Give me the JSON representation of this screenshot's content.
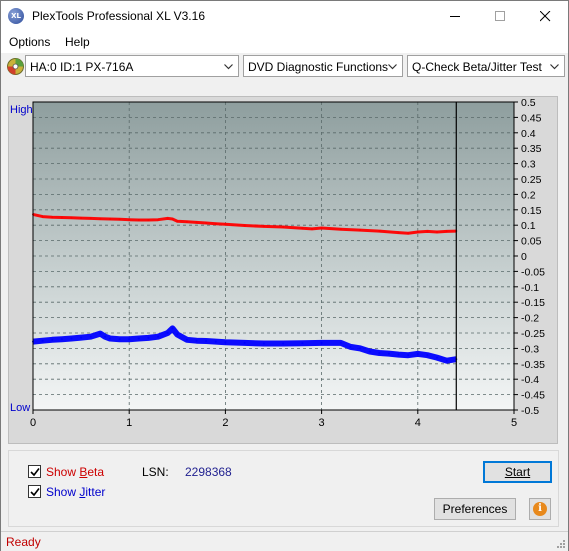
{
  "window": {
    "title": "PlexTools Professional XL V3.16",
    "app_icon_text": "XL"
  },
  "menu": {
    "options": "Options",
    "help": "Help"
  },
  "toolbar": {
    "drive": "HA:0 ID:1  PX-716A",
    "function": "DVD Diagnostic Functions",
    "test": "Q-Check Beta/Jitter Test"
  },
  "chart_data": {
    "type": "line",
    "title": "",
    "xlabel": "",
    "ylabel": "",
    "left_axis": {
      "top_label": "High",
      "bottom_label": "Low"
    },
    "xlim": [
      0,
      5
    ],
    "x_ticks": [
      "0",
      "1",
      "2",
      "3",
      "4",
      "5"
    ],
    "ylim": [
      -0.5,
      0.5
    ],
    "y_ticks": [
      "0.5",
      "0.45",
      "0.4",
      "0.35",
      "0.3",
      "0.25",
      "0.2",
      "0.15",
      "0.1",
      "0.05",
      "0",
      "-0.05",
      "-0.1",
      "-0.15",
      "-0.2",
      "-0.25",
      "-0.3",
      "-0.35",
      "-0.4",
      "-0.45",
      "-0.5"
    ],
    "grid": true,
    "end_marker_x": 4.4,
    "colors": {
      "beta": "#ff0000",
      "jitter": "#0000ff",
      "marker": "#000000"
    },
    "series": [
      {
        "key": "beta",
        "x": [
          0,
          0.1,
          0.2,
          0.3,
          0.4,
          0.5,
          0.6,
          0.7,
          0.8,
          0.9,
          1.0,
          1.1,
          1.2,
          1.3,
          1.4,
          1.45,
          1.5,
          1.6,
          1.7,
          1.8,
          1.9,
          2.0,
          2.2,
          2.4,
          2.6,
          2.8,
          2.9,
          3.0,
          3.2,
          3.4,
          3.6,
          3.8,
          3.9,
          4.0,
          4.1,
          4.2,
          4.3,
          4.4
        ],
        "values": [
          0.135,
          0.128,
          0.126,
          0.125,
          0.124,
          0.123,
          0.122,
          0.121,
          0.12,
          0.119,
          0.118,
          0.117,
          0.117,
          0.118,
          0.122,
          0.12,
          0.113,
          0.111,
          0.109,
          0.107,
          0.105,
          0.103,
          0.099,
          0.096,
          0.094,
          0.09,
          0.088,
          0.091,
          0.087,
          0.084,
          0.081,
          0.076,
          0.074,
          0.078,
          0.08,
          0.078,
          0.08,
          0.081
        ]
      },
      {
        "key": "jitter",
        "x": [
          0,
          0.1,
          0.2,
          0.3,
          0.4,
          0.5,
          0.6,
          0.7,
          0.75,
          0.8,
          0.9,
          1.0,
          1.1,
          1.2,
          1.3,
          1.4,
          1.45,
          1.5,
          1.6,
          1.7,
          1.8,
          1.9,
          2.0,
          2.2,
          2.4,
          2.6,
          2.8,
          3.0,
          3.2,
          3.3,
          3.4,
          3.5,
          3.6,
          3.7,
          3.8,
          3.9,
          4.0,
          4.1,
          4.2,
          4.3,
          4.4
        ],
        "values": [
          -0.278,
          -0.275,
          -0.272,
          -0.27,
          -0.268,
          -0.265,
          -0.262,
          -0.252,
          -0.262,
          -0.268,
          -0.27,
          -0.27,
          -0.268,
          -0.266,
          -0.262,
          -0.25,
          -0.235,
          -0.255,
          -0.272,
          -0.275,
          -0.276,
          -0.278,
          -0.28,
          -0.282,
          -0.284,
          -0.284,
          -0.283,
          -0.282,
          -0.282,
          -0.295,
          -0.3,
          -0.31,
          -0.315,
          -0.317,
          -0.32,
          -0.322,
          -0.318,
          -0.322,
          -0.33,
          -0.34,
          -0.335
        ]
      }
    ]
  },
  "controls": {
    "show_beta": {
      "prefix": "Show ",
      "accel": "B",
      "rest": "eta",
      "checked": true
    },
    "show_jitter": {
      "prefix": "Show ",
      "accel": "J",
      "rest": "itter",
      "checked": true
    },
    "lsn_label": "LSN:",
    "lsn_value": "2298368",
    "start_button": "Start",
    "preferences_button": "Preferences",
    "info_icon": "i"
  },
  "status": {
    "text": "Ready"
  }
}
